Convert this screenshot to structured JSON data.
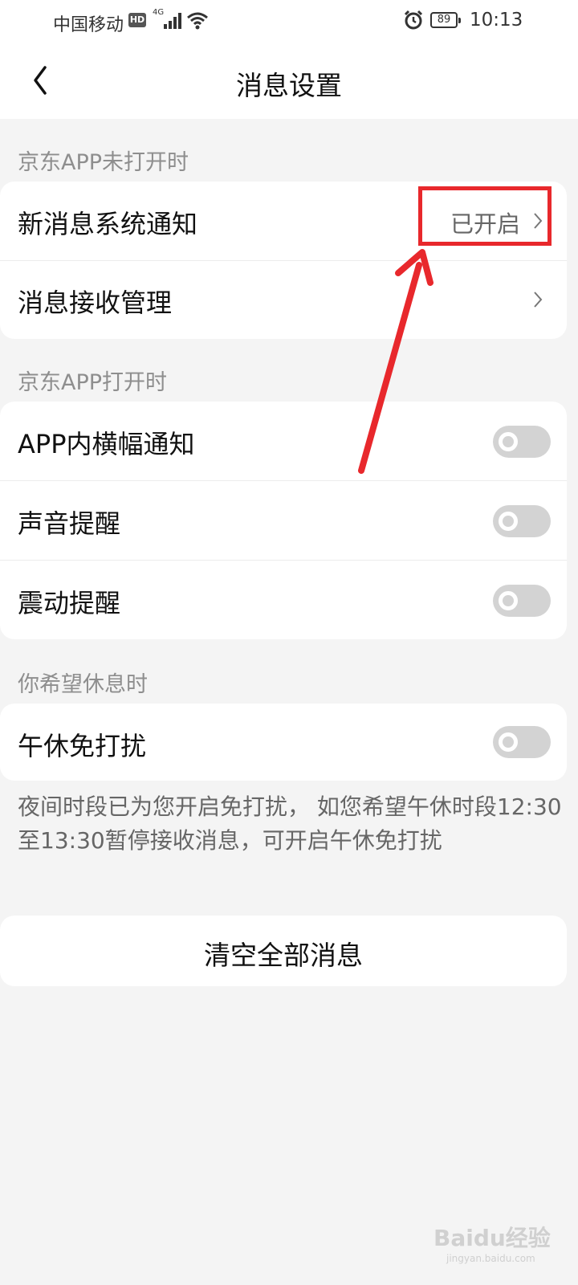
{
  "status_bar": {
    "carrier": "中国移动",
    "hd": "HD",
    "network": "4G",
    "battery": "89",
    "time": "10:13"
  },
  "nav": {
    "title": "消息设置"
  },
  "sections": {
    "app_closed": {
      "label": "京东APP未打开时",
      "rows": [
        {
          "label": "新消息系统通知",
          "value": "已开启"
        },
        {
          "label": "消息接收管理"
        }
      ]
    },
    "app_open": {
      "label": "京东APP打开时",
      "rows": [
        {
          "label": "APP内横幅通知",
          "on": false
        },
        {
          "label": "声音提醒",
          "on": false
        },
        {
          "label": "震动提醒",
          "on": false
        }
      ]
    },
    "rest": {
      "label": "你希望休息时",
      "rows": [
        {
          "label": "午休免打扰",
          "on": false
        }
      ]
    }
  },
  "note": "夜间时段已为您开启免打扰， 如您希望午休时段12:30至13:30暂停接收消息，可开启午休免打扰",
  "clear_button": "清空全部消息",
  "watermark": {
    "text": "Baidu经验",
    "sub": "jingyan.baidu.com"
  },
  "colors": {
    "annotation": "#e8282c",
    "toggle_off": "#d3d3d3",
    "background": "#f4f4f4"
  }
}
